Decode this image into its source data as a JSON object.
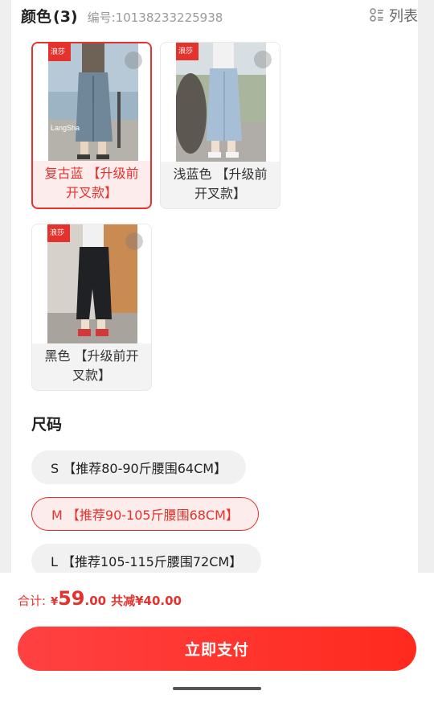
{
  "color_section": {
    "title": "颜色",
    "count": "(3)",
    "code_label": "编号: ",
    "code_value": "10138233225938",
    "view_toggle": {
      "icon": "list-icon",
      "label": "列表"
    },
    "options": [
      {
        "label": "复古蓝 【升级前开叉款】",
        "selected": true,
        "logo": "浪莎"
      },
      {
        "label": "浅蓝色 【升级前开叉款】",
        "selected": false,
        "logo": "浪莎"
      },
      {
        "label": "黑色 【升级前开叉款】",
        "selected": false,
        "logo": "浪莎"
      }
    ],
    "photo_watermark": "LangSha"
  },
  "size_section": {
    "title": "尺码",
    "options": [
      {
        "label": "S 【推荐80-90斤腰围64CM】",
        "selected": false
      },
      {
        "label": "M 【推荐90-105斤腰围68CM】",
        "selected": true
      },
      {
        "label": "L 【推荐105-115斤腰围72CM】",
        "selected": false
      }
    ]
  },
  "footer": {
    "total_label": "合计:",
    "currency": "¥",
    "price_int": "59",
    "price_dec": ".00",
    "discount": "共减¥40.00",
    "pay_button": "立即支付"
  },
  "colors": {
    "accent": "#e5322d",
    "button": "#ff3a33"
  }
}
